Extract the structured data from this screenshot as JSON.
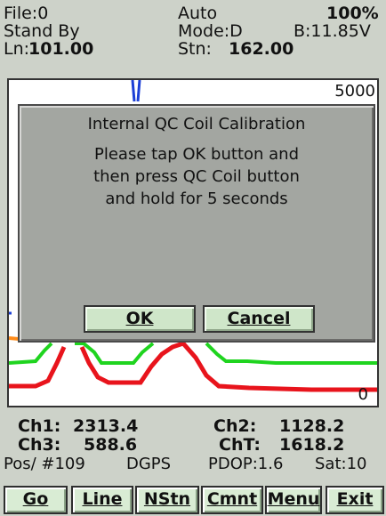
{
  "header": {
    "file": "File:0",
    "auto": "Auto",
    "battery_pct": "100%",
    "status": "Stand By",
    "mode": "Mode:D",
    "voltage": "B:11.85V",
    "ln_label": "Ln:",
    "ln_value": "101.00",
    "stn_label": "Stn:",
    "stn_value": "162.00"
  },
  "plot": {
    "y_max_label": "5000",
    "y_min_label": "0",
    "colors": {
      "red": "#e8141c",
      "green": "#1fd41f",
      "orange": "#ff8c1a",
      "blue": "#1c3fd6"
    }
  },
  "dialog": {
    "title": "Internal QC Coil Calibration",
    "message_lines": [
      "Please tap OK button and",
      "then press QC Coil button",
      "and hold for 5 seconds"
    ],
    "ok_label": "OK",
    "cancel_label": "Cancel"
  },
  "readings": {
    "ch1_label": "Ch1:",
    "ch1_value": "2313.4",
    "ch2_label": "Ch2:",
    "ch2_value": "1128.2",
    "ch3_label": "Ch3:",
    "ch3_value": "588.6",
    "cht_label": "ChT:",
    "cht_value": "1618.2",
    "pos": "Pos/ #109",
    "gps": "DGPS",
    "pdop": "PDOP:1.6",
    "sat": "Sat:10"
  },
  "buttons": {
    "go": "Go",
    "line": "Line",
    "nstn": "NStn",
    "cmnt": "Cmnt",
    "menu": "Menu",
    "exit": "Exit"
  }
}
